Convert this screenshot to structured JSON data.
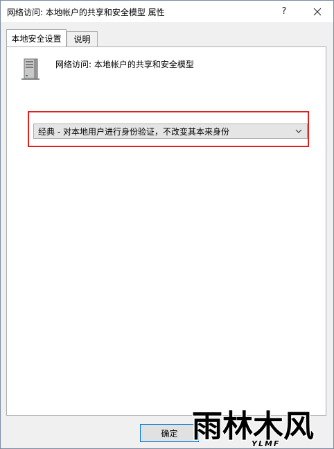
{
  "window": {
    "title": "网络访问: 本地帐户的共享和安全模型 属性",
    "help_label": "?"
  },
  "tabs": [
    {
      "label": "本地安全设置",
      "active": true
    },
    {
      "label": "说明",
      "active": false
    }
  ],
  "policy": {
    "icon": "server-computer-icon",
    "title": "网络访问: 本地帐户的共享和安全模型"
  },
  "dropdown": {
    "selected": "经典 - 对本地用户进行身份验证，不改变其本来身份"
  },
  "buttons": {
    "ok_label": "确定"
  },
  "watermark": {
    "text": "雨林木风",
    "subtext": "YLMF"
  },
  "colors": {
    "highlight_border": "#e02020",
    "focus_border": "#0078d7"
  }
}
